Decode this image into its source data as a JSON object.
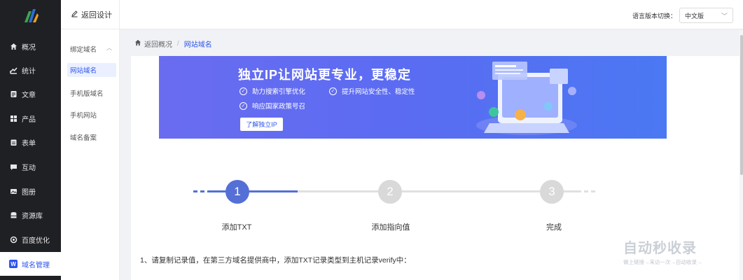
{
  "sidebar": {
    "items": [
      {
        "label": "概况",
        "icon": "home-icon",
        "glyph": "⌂"
      },
      {
        "label": "统计",
        "icon": "chart-icon",
        "glyph": "⧉"
      },
      {
        "label": "文章",
        "icon": "article-icon",
        "glyph": "▤"
      },
      {
        "label": "产品",
        "icon": "product-icon",
        "glyph": "▦"
      },
      {
        "label": "表单",
        "icon": "form-icon",
        "glyph": "▣"
      },
      {
        "label": "互动",
        "icon": "chat-icon",
        "glyph": "▭"
      },
      {
        "label": "图册",
        "icon": "album-icon",
        "glyph": "▨"
      },
      {
        "label": "资源库",
        "icon": "database-icon",
        "glyph": "☰"
      },
      {
        "label": "百度优化",
        "icon": "seo-icon",
        "glyph": "◎"
      },
      {
        "label": "域名管理",
        "icon": "domain-icon",
        "glyph": "W"
      }
    ]
  },
  "submenu": {
    "back_label": "返回设计",
    "group_label": "绑定域名",
    "items": [
      "网站域名",
      "手机版域名",
      "手机网站",
      "域名备案"
    ]
  },
  "topbar": {
    "lang_label": "语言版本切换：",
    "lang_value": "中文版"
  },
  "breadcrumb": {
    "home": "返回概况",
    "current": "网站域名"
  },
  "banner": {
    "title": "独立IP让网站更专业，更稳定",
    "features": [
      "助力搜索引擎优化",
      "提升网站安全性、稳定性",
      "响应国家政策号召"
    ],
    "button": "了解独立IP"
  },
  "steps": [
    {
      "number": "1",
      "label": "添加TXT",
      "state": "active"
    },
    {
      "number": "2",
      "label": "添加指向值",
      "state": "pending"
    },
    {
      "number": "3",
      "label": "完成",
      "state": "pending"
    }
  ],
  "instruction": "1、请复制记录值，在第三方域名提供商中，添加TXT记录类型到主机记录verify中：",
  "watermark": {
    "main": "自动秒收录",
    "sub": "做上链接→来访一次→自动收录→"
  },
  "colors": {
    "accent": "#2f54eb",
    "step_active": "#5470d6",
    "step_pending": "#d9d9d9",
    "sidebar_bg": "#1f2024"
  }
}
